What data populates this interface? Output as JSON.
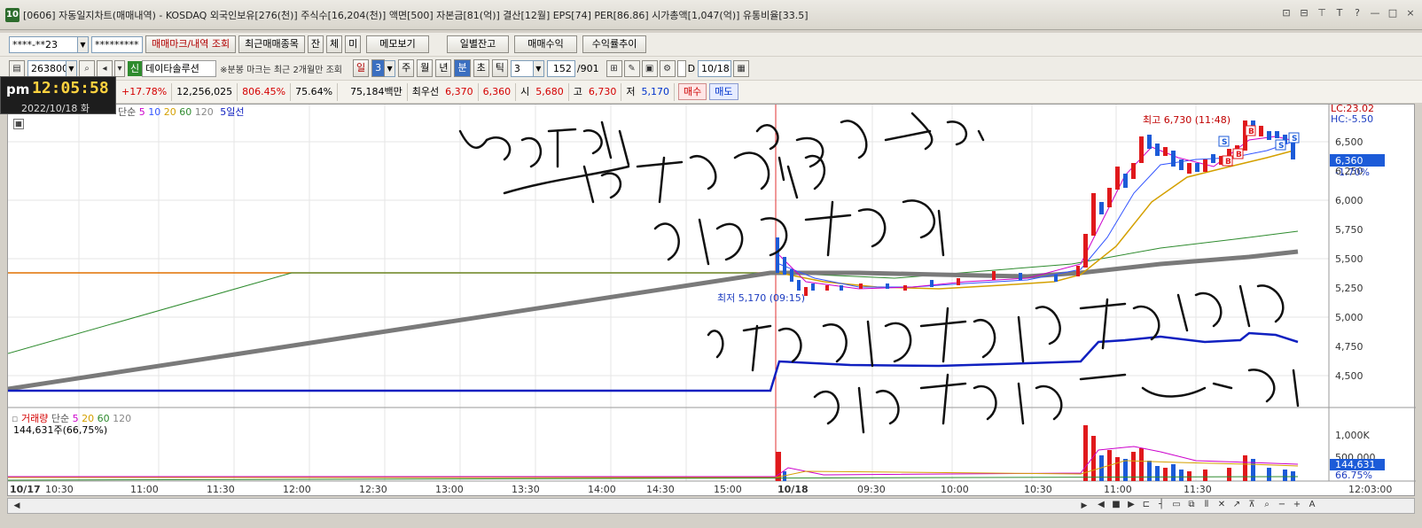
{
  "window": {
    "title": "[0606] 자동일지차트(매매내역) - KOSDAQ 외국인보유[276(천)] 주식수[16,204(천)] 액면[500] 자본금[81(억)] 결산[12월] EPS[74] PER[86.86] 시가총액[1,047(억)] 유통비율[33.5]",
    "app_icon": "10",
    "controls": [
      "⊡",
      "⊟",
      "⊤",
      "T",
      "?",
      "—",
      "□",
      "×"
    ]
  },
  "toolbar1": {
    "account": "****-**23",
    "password": "*********",
    "btn_mark": "매매마크/내역 조회",
    "btn_recent": "최근매매종목",
    "btn_jan": "잔",
    "btn_che": "체",
    "btn_mi": "미",
    "btn_memo": "메모보기",
    "btn_daily": "일별잔고",
    "btn_profit": "매매수익",
    "btn_trend": "수익률추이"
  },
  "toolbar2": {
    "code": "263800",
    "sin": "신",
    "stock_name": "데이타솔루션",
    "notice": "※분봉 마크는 최근 2개월만 조회",
    "period_day": "일",
    "period_day_n": "3",
    "week": "주",
    "month": "월",
    "year": "년",
    "minute": "분",
    "second": "초",
    "tick": "틱",
    "interval": "3",
    "count": "152",
    "total": "/901",
    "check_label": "D",
    "date": "10/18"
  },
  "quote": {
    "change_rate": "+17.78%",
    "volume": "12,256,025",
    "vol_rate": "806.45%",
    "ratio": "75.64%",
    "amount": "75,184백만",
    "best_label": "최우선",
    "ask": "6,370",
    "bid": "6,360",
    "open_label": "시",
    "open": "5,680",
    "high_label": "고",
    "high": "6,730",
    "low_label": "저",
    "low": "5,170",
    "buy": "매수",
    "sell": "매도"
  },
  "clock": {
    "ampm": "pm",
    "time": "12:05:58",
    "date": "2022/10/18 화"
  },
  "legend_price": {
    "prefix": "단순",
    "ma": [
      "5",
      "10",
      "20",
      "60",
      "120"
    ],
    "line5": "5일선",
    "colors": [
      "#cc00cc",
      "#3355ff",
      "#d4a000",
      "#2e8b2e",
      "#888888"
    ]
  },
  "legend_volume": {
    "label": "거래량",
    "prefix": "단순",
    "ma": [
      "5",
      "20",
      "60",
      "120"
    ],
    "value": "144,631주(66,75%)"
  },
  "right_badges": {
    "lc": "LC:23.02",
    "hc": "HC:-5.50",
    "current_price": "6,360",
    "current_rate": "-1.70%",
    "current_volume": "144,631",
    "volume_rate": "66.75%"
  },
  "price_axis": [
    "6,500",
    "6,250",
    "6,000",
    "5,750",
    "5,500",
    "5,250",
    "5,000",
    "4,750",
    "4,500"
  ],
  "volume_axis": [
    "1,000K",
    "500,000"
  ],
  "time_axis": {
    "day1": "10/17",
    "day2": "10/18",
    "labels_day1": [
      "10:30",
      "11:00",
      "11:30",
      "12:00",
      "12:30",
      "13:00",
      "13:30",
      "14:00",
      "14:30",
      "15:00"
    ],
    "labels_day2": [
      "09:30",
      "10:00",
      "10:30",
      "11:00",
      "11:30"
    ],
    "end": "12:03:00"
  },
  "annotations": {
    "high": "최고 6,730 (11:48)",
    "low": "최저 5,170 (09:15)",
    "marks": [
      "S",
      "B",
      "B",
      "B",
      "S",
      "S"
    ]
  },
  "colors": {
    "up": "#e0191c",
    "down": "#1c5bd8",
    "ma_gray": "#7a7a7a",
    "blue_line": "#1020c0",
    "handwriting": "#111111"
  }
}
